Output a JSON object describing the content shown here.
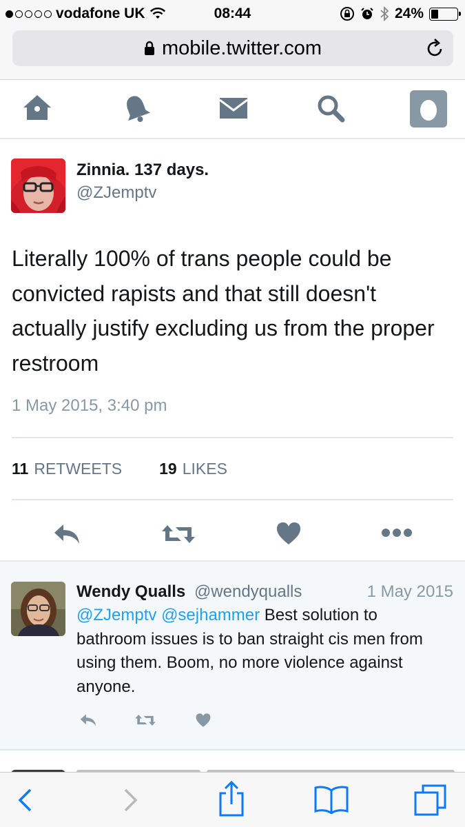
{
  "status_bar": {
    "carrier": "vodafone UK",
    "signal_bars_filled": 1,
    "signal_bars_total": 5,
    "time": "08:44",
    "battery_percent": "24%",
    "battery_level": 0.24
  },
  "browser": {
    "url": "mobile.twitter.com",
    "lock_icon": "lock-icon",
    "reload_icon": "reload-icon"
  },
  "nav": {
    "items": [
      {
        "icon": "home-icon"
      },
      {
        "icon": "bell-icon"
      },
      {
        "icon": "envelope-icon"
      },
      {
        "icon": "search-icon"
      },
      {
        "icon": "profile-egg-icon"
      }
    ]
  },
  "tweet": {
    "author_name": "Zinnia. 137 days.",
    "author_handle": "@ZJemptv",
    "text": "Literally 100% of trans people could be convicted rapists and that still doesn't actually justify excluding us from the proper restroom",
    "date": "1 May 2015, 3:40 pm",
    "retweet_count": "11",
    "retweet_label": "RETWEETS",
    "like_count": "19",
    "like_label": "LIKES"
  },
  "reply": {
    "author_name": "Wendy Qualls",
    "author_handle": "@wendyqualls",
    "date": "1 May 2015",
    "mention1": "@ZJemptv",
    "mention2": "@sejhammer",
    "text": "Best solution to bathroom issues is to ban straight cis men from using them.  Boom, no more violence against anyone."
  },
  "colors": {
    "twitter_blue": "#1da1f2",
    "icon_gray": "#657786",
    "safari_blue": "#0a7aff"
  }
}
